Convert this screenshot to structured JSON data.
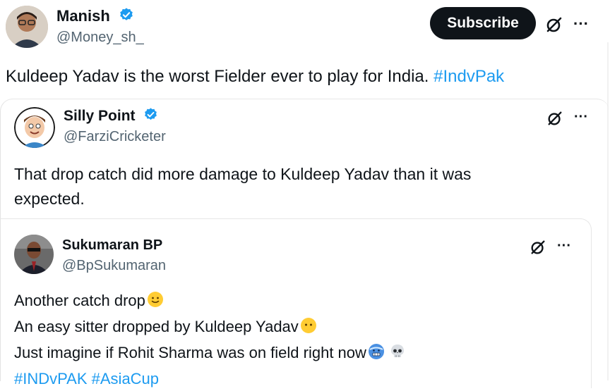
{
  "main_tweet": {
    "author_name": "Manish",
    "author_handle": "@Money_sh_",
    "subscribe_label": "Subscribe",
    "more_label": "···",
    "text": "Kuldeep Yadav is the worst Fielder ever to play for India. ",
    "hashtag": "#IndvPak"
  },
  "quote_1": {
    "author_name": "Silly Point",
    "author_handle": "@FarziCricketer",
    "more_label": "···",
    "text_line1": "That drop catch did more damage to Kuldeep Yadav than it was",
    "text_line2": "expected."
  },
  "quote_2": {
    "author_name": "Sukumaran BP",
    "author_handle": "@BpSukumaran",
    "more_label": "···",
    "line1": "Another catch drop",
    "line2": "An easy sitter dropped by Kuldeep Yadav",
    "line3": "Just imagine if Rohit Sharma was on field right now",
    "hashtag1": "#INDvPAK",
    "hashtag2": "#AsiaCup"
  },
  "colors": {
    "verified": "#1d9bf0",
    "hashtag": "#1d9bf0",
    "subscribe_bg": "#0f1419",
    "handle": "#536471"
  },
  "icons": {
    "verified": "verified-badge-icon",
    "grok": "grok-icon",
    "more": "more-icon",
    "emoji1": "slightly-smiling-face-icon",
    "emoji2": "face-without-mouth-icon",
    "emoji3": "cold-face-icon",
    "emoji4": "skull-icon"
  }
}
